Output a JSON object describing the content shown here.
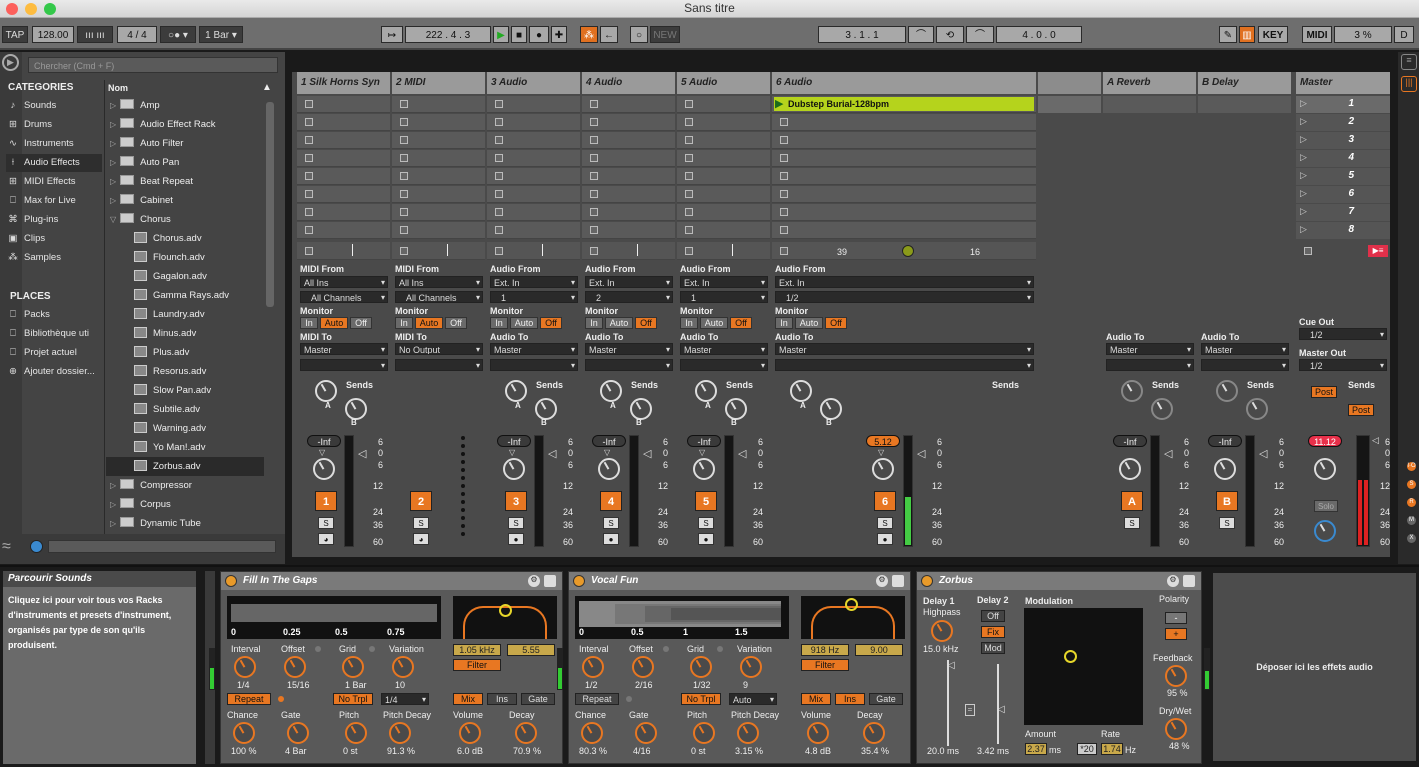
{
  "window": {
    "title": "Sans titre"
  },
  "toolbar": {
    "tap": "TAP",
    "tempo": "128.00",
    "sig_num": "4",
    "sig_slash": "/",
    "sig_den": "4",
    "quant": "1 Bar",
    "position": "222 .  4 .  3",
    "new": "NEW",
    "loop_start": "3 .  1 .  1",
    "loop_len": "4 .  0 .  0",
    "key": "KEY",
    "midi": "MIDI",
    "cpu": "3 %",
    "d": "D"
  },
  "browser": {
    "search_placeholder": "Chercher (Cmd + F)",
    "categories_title": "CATEGORIES",
    "name_header": "Nom",
    "categories": [
      "Sounds",
      "Drums",
      "Instruments",
      "Audio Effects",
      "MIDI Effects",
      "Max for Live",
      "Plug-ins",
      "Clips",
      "Samples"
    ],
    "places_title": "PLACES",
    "places": [
      "Packs",
      "Bibliothèque uti",
      "Projet actuel",
      "Ajouter dossier..."
    ],
    "items": [
      "Amp",
      "Audio Effect Rack",
      "Auto Filter",
      "Auto Pan",
      "Beat Repeat",
      "Cabinet",
      "Chorus",
      "Chorus.adv",
      "Flounch.adv",
      "Gagalon.adv",
      "Gamma Rays.adv",
      "Laundry.adv",
      "Minus.adv",
      "Plus.adv",
      "Resorus.adv",
      "Slow Pan.adv",
      "Subtile.adv",
      "Warning.adv",
      "Yo Man!.adv",
      "Zorbus.adv",
      "Compressor",
      "Corpus",
      "Dynamic Tube"
    ]
  },
  "tracks": [
    {
      "name": "1 Silk Horns Syn",
      "num": "1",
      "from": "MIDI From",
      "in1": "All Ins",
      "in2": "All Channels",
      "mon": "Monitor",
      "to": "MIDI To",
      "out": "Master",
      "vol": "-Inf"
    },
    {
      "name": "2 MIDI",
      "num": "2",
      "from": "MIDI From",
      "in1": "All Ins",
      "in2": "All Channels",
      "mon": "Monitor",
      "to": "MIDI To",
      "out": "No Output",
      "vol": ""
    },
    {
      "name": "3 Audio",
      "num": "3",
      "from": "Audio From",
      "in1": "Ext. In",
      "in2": "1",
      "mon": "Monitor",
      "to": "Audio To",
      "out": "Master",
      "vol": "-Inf"
    },
    {
      "name": "4 Audio",
      "num": "4",
      "from": "Audio From",
      "in1": "Ext. In",
      "in2": "2",
      "mon": "Monitor",
      "to": "Audio To",
      "out": "Master",
      "vol": "-Inf"
    },
    {
      "name": "5 Audio",
      "num": "5",
      "from": "Audio From",
      "in1": "Ext. In",
      "in2": "1",
      "mon": "Monitor",
      "to": "Audio To",
      "out": "Master",
      "vol": "-Inf"
    },
    {
      "name": "6 Audio",
      "num": "6",
      "from": "Audio From",
      "in1": "Ext. In",
      "in2": "1/2",
      "mon": "Monitor",
      "to": "Audio To",
      "out": "Master",
      "vol": "5.12"
    }
  ],
  "monitor": {
    "in": "In",
    "auto": "Auto",
    "off": "Off"
  },
  "clip": {
    "name": "Dubstep Burial-128bpm",
    "left": "39",
    "right": "16"
  },
  "returns": [
    {
      "name": "A Reverb",
      "letter": "A",
      "to": "Audio To",
      "out": "Master",
      "vol": "-Inf"
    },
    {
      "name": "B Delay",
      "letter": "B",
      "to": "Audio To",
      "out": "Master",
      "vol": "-Inf"
    }
  ],
  "master": {
    "name": "Master",
    "scenes": [
      "1",
      "2",
      "3",
      "4",
      "5",
      "6",
      "7",
      "8"
    ],
    "cue": "Cue Out",
    "cue_val": "1/2",
    "mout": "Master Out",
    "mout_val": "1/2",
    "post": "Post",
    "solo": "Solo",
    "vol": "11.12"
  },
  "sends": "Sends",
  "scale": [
    "6",
    "0",
    "6",
    "12",
    "24",
    "36",
    "60"
  ],
  "info": {
    "title": "Parcourir Sounds",
    "text": "Cliquez ici pour voir tous vos Racks d'instruments et presets d'instrument, organisés par type de son qu'ils produisent."
  },
  "devices": [
    {
      "name": "Fill In The Gaps",
      "ticks": [
        "0",
        "0.25",
        "0.5",
        "0.75"
      ],
      "freq": "1.05 kHz",
      "q": "5.55",
      "filter": "Filter",
      "k1": [
        "Interval",
        "Offset",
        "Grid",
        "Variation"
      ],
      "v1": [
        "1/4",
        "15/16",
        "1 Bar",
        "10"
      ],
      "repeat": "Repeat",
      "notrpl": "No Trpl",
      "grid2": "1/4",
      "mix": "Mix",
      "ins": "Ins",
      "gate": "Gate",
      "k2": [
        "Chance",
        "Gate",
        "Pitch",
        "Pitch Decay",
        "Volume",
        "Decay"
      ],
      "v2": [
        "100 %",
        "4 Bar",
        "0 st",
        "91.3 %",
        "6.0 dB",
        "70.9 %"
      ]
    },
    {
      "name": "Vocal Fun",
      "ticks": [
        "0",
        "0.5",
        "1",
        "1.5"
      ],
      "freq": "918 Hz",
      "q": "9.00",
      "filter": "Filter",
      "k1": [
        "Interval",
        "Offset",
        "Grid",
        "Variation"
      ],
      "v1": [
        "1/2",
        "2/16",
        "1/32",
        "9"
      ],
      "repeat": "Repeat",
      "notrpl": "No Trpl",
      "grid2": "Auto",
      "mix": "Mix",
      "ins": "Ins",
      "gate": "Gate",
      "k2": [
        "Chance",
        "Gate",
        "Pitch",
        "Pitch Decay",
        "Volume",
        "Decay"
      ],
      "v2": [
        "80.3 %",
        "4/16",
        "0 st",
        "3.15 %",
        "4.8 dB",
        "35.4 %"
      ]
    }
  ],
  "zorbus": {
    "name": "Zorbus",
    "d1": "Delay 1",
    "hp": "Highpass",
    "hpv": "15.0 kHz",
    "d2": "Delay 2",
    "off": "Off",
    "fix": "Fix",
    "mod": "Mod",
    "d1ms": "20.0 ms",
    "d2ms": "3.42 ms",
    "modulation": "Modulation",
    "amount": "Amount",
    "rate": "Rate",
    "amountv": "2.37",
    "ms": "ms",
    "x20": "*20",
    "ratev": "1.74",
    "hz": "Hz",
    "polarity": "Polarity",
    "minus": "-",
    "plus": "+",
    "fb": "Feedback",
    "fbv": "95 %",
    "dw": "Dry/Wet",
    "dwv": "48 %"
  },
  "drop": "Déposer ici les effets audio"
}
